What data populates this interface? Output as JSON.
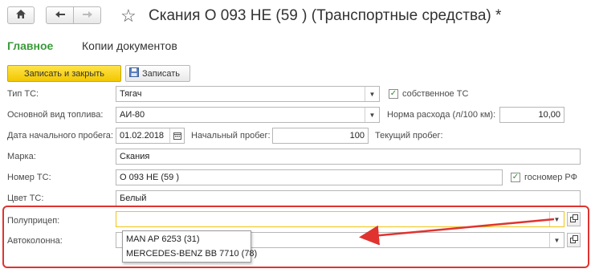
{
  "header": {
    "title": "Скания О 093 НЕ (59 ) (Транспортные средства) *"
  },
  "tabs": [
    {
      "label": "Главное"
    },
    {
      "label": "Копии документов"
    }
  ],
  "toolbar": {
    "save_close_label": "Записать и закрыть",
    "save_label": "Записать"
  },
  "form": {
    "vehicle_type": {
      "label": "Тип ТС:",
      "value": "Тягач"
    },
    "own_vehicle": {
      "label": "собственное ТС",
      "checked": true
    },
    "fuel_type": {
      "label": "Основной вид топлива:",
      "value": "АИ-80"
    },
    "consumption": {
      "label": "Норма расхода (л/100 км):",
      "value": "10,00"
    },
    "mileage_start_date": {
      "label": "Дата начального пробега:",
      "value": "01.02.2018"
    },
    "mileage_start": {
      "label": "Начальный пробег:",
      "value": "100"
    },
    "mileage_current": {
      "label": "Текущий пробег:"
    },
    "brand": {
      "label": "Марка:",
      "value": "Скания"
    },
    "plate": {
      "label": "Номер ТС:",
      "value": "О 093 НЕ (59 )"
    },
    "gov_plate": {
      "label": "госномер РФ",
      "checked": true
    },
    "color": {
      "label": "Цвет ТС:",
      "value": "Белый"
    },
    "trailer": {
      "label": "Полуприцеп:",
      "value": ""
    },
    "convoy": {
      "label": "Автоколонна:",
      "value": ""
    }
  },
  "trailer_dropdown": {
    "options": [
      "MAN AP 6253 (31)",
      "MERCEDES-BENZ BB 7710 (78)"
    ]
  },
  "colors": {
    "accent_green": "#3a9a3a",
    "primary_yellow": "#f2c800",
    "highlight_red": "#e0332f",
    "focus_yellow": "#f0c419"
  }
}
